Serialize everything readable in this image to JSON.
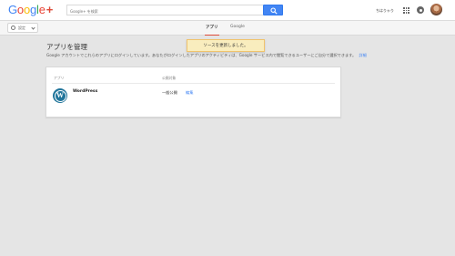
{
  "header": {
    "logo_letters": [
      "G",
      "o",
      "o",
      "g",
      "l",
      "e"
    ],
    "logo_plus": "+",
    "search_placeholder": "Google+ を検索",
    "user_name": "ちはりゃり"
  },
  "subbar": {
    "filter_label": "設定",
    "tabs": [
      {
        "label": "アプリ",
        "active": true
      },
      {
        "label": "Google",
        "active": false
      }
    ]
  },
  "toast": {
    "message": "ソースを更新しました。"
  },
  "main": {
    "title": "アプリを管理",
    "description": "Google アカウントでこれらのアプリにログインしています。あなたがログインしたアプリのアクティビティは、Google サービス内で閲覧できるユーザーにご自分で選択できます。",
    "details_link": "詳細"
  },
  "apps_table": {
    "columns": [
      "アプリ",
      "公開対象"
    ],
    "rows": [
      {
        "name": "WordPress",
        "visibility": "一般公開",
        "edit_label": "編集"
      }
    ]
  },
  "colors": {
    "accent_blue": "#4285f4",
    "active_tab_underline": "#dd4b39",
    "toast_bg": "#f9edbe",
    "wordpress_blue": "#21759b"
  }
}
